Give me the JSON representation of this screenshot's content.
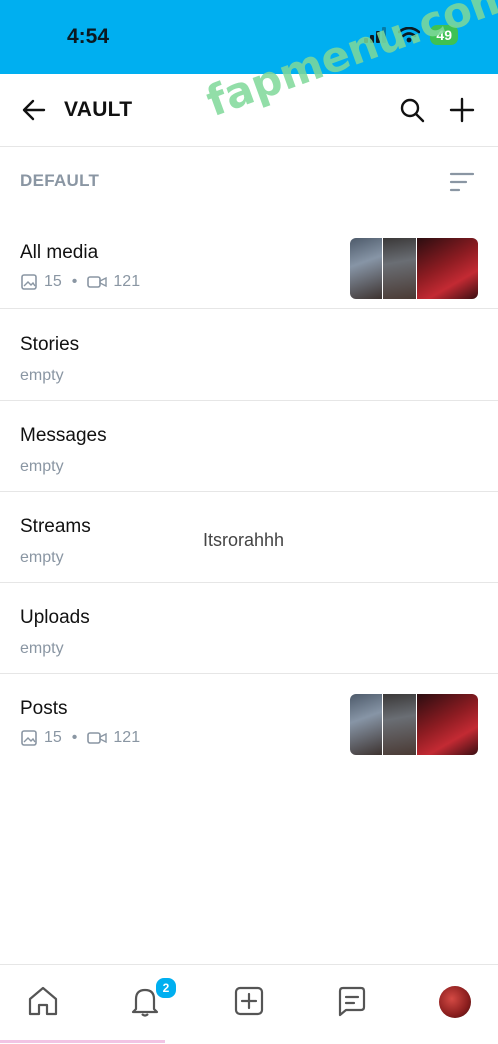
{
  "status": {
    "time": "4:54",
    "battery": "49"
  },
  "header": {
    "title": "VAULT"
  },
  "watermark": "fapmenu.com",
  "section": {
    "label": "DEFAULT"
  },
  "lists": [
    {
      "title": "All media",
      "photos": "15",
      "videos": "121",
      "sub": ""
    },
    {
      "title": "Stories",
      "sub": "empty"
    },
    {
      "title": "Messages",
      "sub": "empty"
    },
    {
      "title": "Streams",
      "sub": "empty"
    },
    {
      "title": "Uploads",
      "sub": "empty"
    },
    {
      "title": "Posts",
      "photos": "15",
      "videos": "121",
      "sub": ""
    }
  ],
  "overlay_caption": "Itsrorahhh",
  "tabbar": {
    "notifications_badge": "2"
  },
  "colors": {
    "accent": "#00aff0",
    "muted": "#8a96a3",
    "battery": "#3ec153"
  },
  "icons": [
    "back-arrow-icon",
    "search-icon",
    "plus-icon",
    "sort-icon",
    "photo-icon",
    "video-icon",
    "home-icon",
    "bell-icon",
    "add-square-icon",
    "messages-icon"
  ]
}
